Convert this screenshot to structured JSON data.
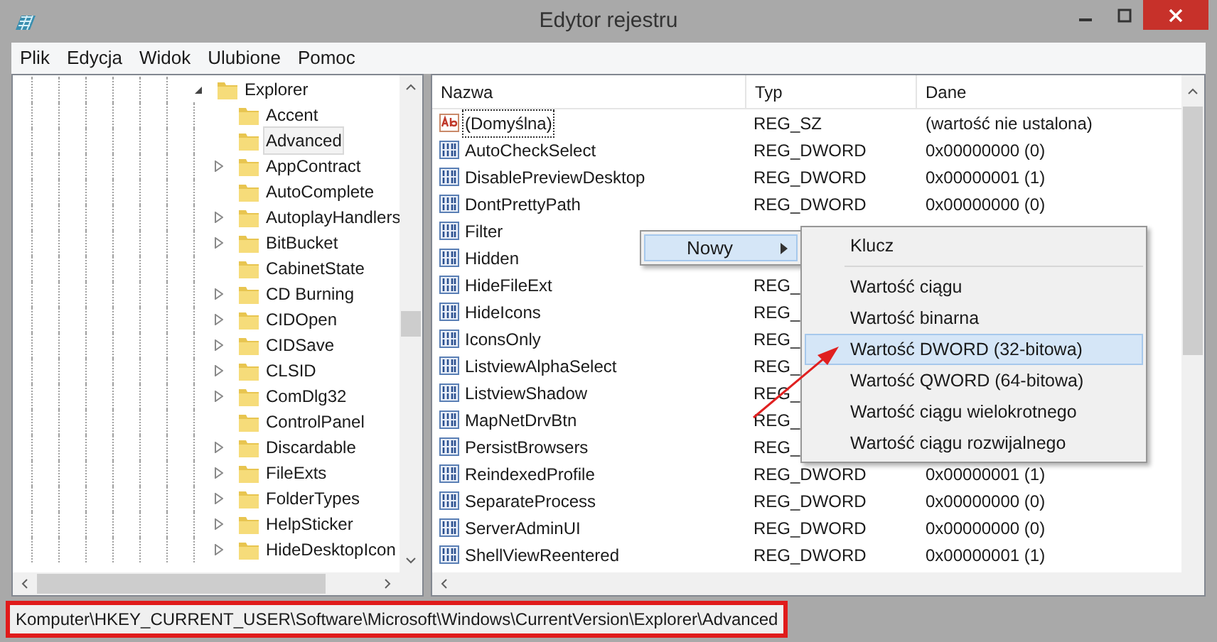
{
  "window": {
    "title": "Edytor rejestru"
  },
  "menu": [
    "Plik",
    "Edycja",
    "Widok",
    "Ulubione",
    "Pomoc"
  ],
  "tree": {
    "label": "Explorer",
    "expanded": true,
    "selected": false,
    "children": [
      {
        "label": "Accent",
        "expandable": false,
        "selected": false
      },
      {
        "label": "Advanced",
        "expandable": false,
        "selected": true
      },
      {
        "label": "AppContract",
        "expandable": true,
        "selected": false
      },
      {
        "label": "AutoComplete",
        "expandable": false,
        "selected": false
      },
      {
        "label": "AutoplayHandlers",
        "expandable": true,
        "selected": false
      },
      {
        "label": "BitBucket",
        "expandable": true,
        "selected": false
      },
      {
        "label": "CabinetState",
        "expandable": false,
        "selected": false
      },
      {
        "label": "CD Burning",
        "expandable": true,
        "selected": false
      },
      {
        "label": "CIDOpen",
        "expandable": true,
        "selected": false
      },
      {
        "label": "CIDSave",
        "expandable": true,
        "selected": false
      },
      {
        "label": "CLSID",
        "expandable": true,
        "selected": false
      },
      {
        "label": "ComDlg32",
        "expandable": true,
        "selected": false
      },
      {
        "label": "ControlPanel",
        "expandable": false,
        "selected": false
      },
      {
        "label": "Discardable",
        "expandable": true,
        "selected": false
      },
      {
        "label": "FileExts",
        "expandable": true,
        "selected": false
      },
      {
        "label": "FolderTypes",
        "expandable": true,
        "selected": false
      },
      {
        "label": "HelpSticker",
        "expandable": true,
        "selected": false
      },
      {
        "label": "HideDesktopIcon",
        "expandable": true,
        "selected": false
      }
    ]
  },
  "table": {
    "columns": [
      "Nazwa",
      "Typ",
      "Dane"
    ],
    "rows": [
      {
        "kind": "string",
        "name": "(Domyślna)",
        "type": "REG_SZ",
        "data": "(wartość nie ustalona)",
        "focused": true
      },
      {
        "kind": "dword",
        "name": "AutoCheckSelect",
        "type": "REG_DWORD",
        "data": "0x00000000 (0)",
        "focused": false
      },
      {
        "kind": "dword",
        "name": "DisablePreviewDesktop",
        "type": "REG_DWORD",
        "data": "0x00000001 (1)",
        "focused": false
      },
      {
        "kind": "dword",
        "name": "DontPrettyPath",
        "type": "REG_DWORD",
        "data": "0x00000000 (0)",
        "focused": false
      },
      {
        "kind": "dword",
        "name": "Filter",
        "focused": false
      },
      {
        "kind": "dword",
        "name": "Hidden",
        "focused": false
      },
      {
        "kind": "dword",
        "name": "HideFileExt",
        "type": "REG_",
        "focused": false
      },
      {
        "kind": "dword",
        "name": "HideIcons",
        "type": "REG_",
        "focused": false
      },
      {
        "kind": "dword",
        "name": "IconsOnly",
        "type": "REG_",
        "focused": false
      },
      {
        "kind": "dword",
        "name": "ListviewAlphaSelect",
        "type": "REG_",
        "focused": false
      },
      {
        "kind": "dword",
        "name": "ListviewShadow",
        "type": "REG_",
        "focused": false
      },
      {
        "kind": "dword",
        "name": "MapNetDrvBtn",
        "type": "REG_",
        "focused": false
      },
      {
        "kind": "dword",
        "name": "PersistBrowsers",
        "type": "REG_",
        "focused": false
      },
      {
        "kind": "dword",
        "name": "ReindexedProfile",
        "type": "REG_DWORD",
        "data": "0x00000001 (1)",
        "focused": false
      },
      {
        "kind": "dword",
        "name": "SeparateProcess",
        "type": "REG_DWORD",
        "data": "0x00000000 (0)",
        "focused": false
      },
      {
        "kind": "dword",
        "name": "ServerAdminUI",
        "type": "REG_DWORD",
        "data": "0x00000000 (0)",
        "focused": false
      },
      {
        "kind": "dword",
        "name": "ShellViewReentered",
        "type": "REG_DWORD",
        "data": "0x00000001 (1)",
        "focused": false
      }
    ]
  },
  "context_menu": {
    "label": "Nowy",
    "selected": true,
    "submenu": [
      {
        "label": "Klucz",
        "selected": false,
        "separator_after": true
      },
      {
        "label": "Wartość ciągu",
        "selected": false,
        "separator_after": false
      },
      {
        "label": "Wartość binarna",
        "selected": false,
        "separator_after": false
      },
      {
        "label": "Wartość DWORD (32-bitowa)",
        "selected": true,
        "separator_after": false
      },
      {
        "label": "Wartość QWORD (64-bitowa)",
        "selected": false,
        "separator_after": false
      },
      {
        "label": "Wartość ciągu wielokrotnego",
        "selected": false,
        "separator_after": false
      },
      {
        "label": "Wartość ciągu rozwijalnego",
        "selected": false,
        "separator_after": false
      }
    ]
  },
  "status_bar": {
    "path": "Komputer\\HKEY_CURRENT_USER\\Software\\Microsoft\\Windows\\CurrentVersion\\Explorer\\Advanced",
    "highlighted": true
  }
}
